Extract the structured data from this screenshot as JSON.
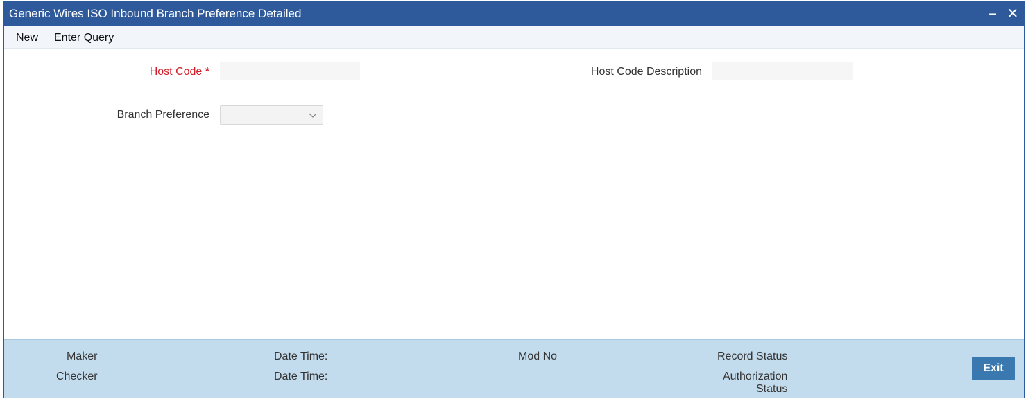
{
  "window": {
    "title": "Generic Wires ISO Inbound Branch Preference Detailed",
    "minimize_glyph": "–",
    "close_glyph": "✕",
    "icons": [
      "minimize-icon",
      "close-icon"
    ]
  },
  "menu": {
    "items": [
      {
        "label": "New"
      },
      {
        "label": "Enter Query"
      }
    ]
  },
  "form": {
    "host_code": {
      "label": "Host Code",
      "required_mark": "*",
      "value": ""
    },
    "host_code_description": {
      "label": "Host Code Description",
      "value": ""
    },
    "branch_preference": {
      "label": "Branch Preference",
      "selected": "",
      "icon": "chevron-down-icon"
    }
  },
  "footer": {
    "maker": "Maker",
    "checker": "Checker",
    "maker_date_time": "Date Time:",
    "checker_date_time": "Date Time:",
    "mod_no": "Mod No",
    "record_status": "Record Status",
    "authorization_status_line1": "Authorization",
    "authorization_status_line2": "Status",
    "exit_label": "Exit"
  },
  "colors": {
    "titlebar": "#2e5a9c",
    "footer": "#c3dced",
    "required": "#d01e2a",
    "exit_button": "#3a78b0"
  }
}
